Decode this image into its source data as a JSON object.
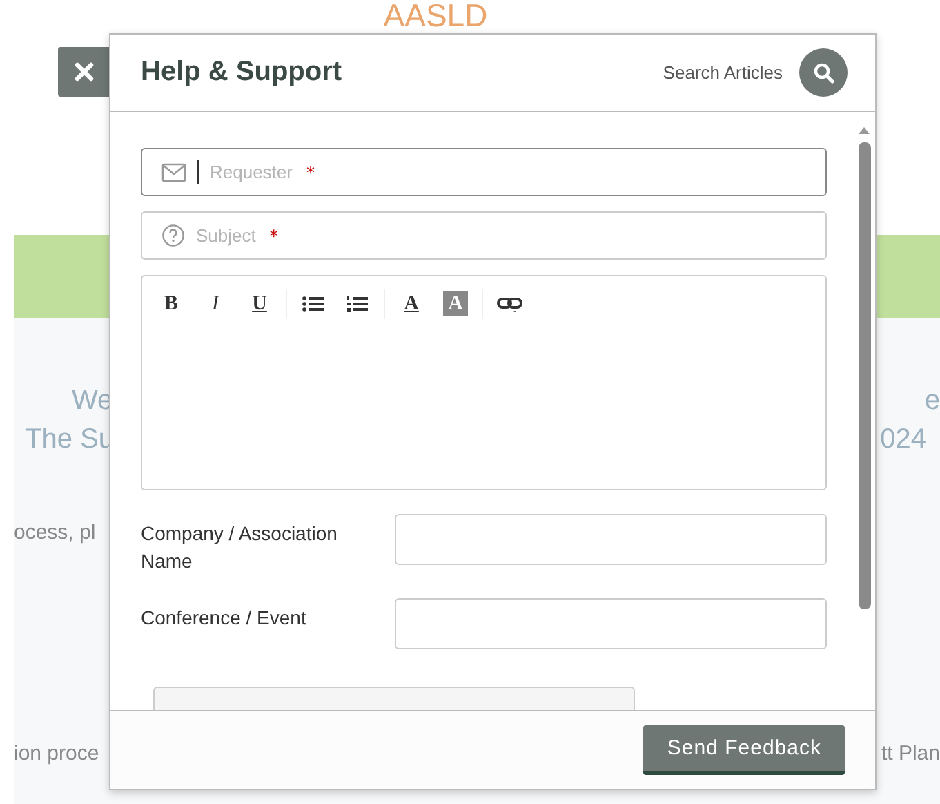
{
  "background_page": {
    "logo": "AASLD",
    "left_fragments": [
      "We",
      "The Su"
    ],
    "right_fragments": [
      "e",
      "024"
    ],
    "line_fragment": "ocess, pl",
    "bottom_left": "ion proce",
    "bottom_right": "tt Plan"
  },
  "dialog": {
    "title": "Help & Support",
    "search_label": "Search Articles",
    "fields": [
      {
        "kind": "email",
        "placeholder": "Requester",
        "required_mark": "*",
        "focused": true
      },
      {
        "kind": "question",
        "placeholder": "Subject",
        "required_mark": "*",
        "focused": false
      }
    ],
    "editor_toolbar": [
      {
        "kind": "bold",
        "label": "B"
      },
      {
        "kind": "italic",
        "label": "I"
      },
      {
        "kind": "underline",
        "label": "U"
      },
      {
        "kind": "separator"
      },
      {
        "kind": "bullets"
      },
      {
        "kind": "numbers"
      },
      {
        "kind": "separator"
      },
      {
        "kind": "color",
        "label": "A"
      },
      {
        "kind": "highlight",
        "label": "A"
      },
      {
        "kind": "separator"
      },
      {
        "kind": "link"
      }
    ],
    "labeled_fields": [
      {
        "label": "Company / Association Name"
      },
      {
        "label": "Conference / Event"
      }
    ],
    "send_button": "Send Feedback"
  }
}
